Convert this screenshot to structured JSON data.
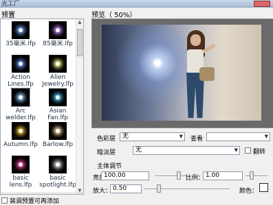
{
  "window": {
    "title": "光工厂"
  },
  "presets": {
    "label": "预置",
    "items": [
      {
        "name": "35毫米.lfp",
        "glow": "#7af"
      },
      {
        "name": "85毫米.lfp",
        "glow": "#c8f"
      },
      {
        "name": "Action Lines.lfp",
        "glow": "#69f"
      },
      {
        "name": "Alien Jewelry.lfp",
        "glow": "#ff8"
      },
      {
        "name": "Arc welder.lfp",
        "glow": "#9cf"
      },
      {
        "name": "Asian Fan.lfp",
        "glow": "#5cf"
      },
      {
        "name": "Autumn.lfp",
        "glow": "#fc3"
      },
      {
        "name": "Barlow.lfp",
        "glow": "#fda"
      },
      {
        "name": "basic lens.lfp",
        "glow": "#f4a"
      },
      {
        "name": "basic spotlight.lfp",
        "glow": "#ddd"
      }
    ],
    "add_checkbox": "装调预置可再添加"
  },
  "preview": {
    "label": "预览（ 50%）"
  },
  "controls": {
    "color_layer_label": "色彩层",
    "color_layer_value": "无",
    "view_label": "查看",
    "view_value": "",
    "fade_layer_label": "暗淡层",
    "fade_layer_value": "无",
    "flip_label": "翻转",
    "group_label": "主体调节",
    "brightness_label": "亮度",
    "brightness_value": "100.00",
    "ratio_label": "比例：",
    "ratio_value": "1.00",
    "zoom_label": "放大：",
    "zoom_value": "0.50",
    "color_label": "颜色：",
    "color_value": "#ffffff"
  }
}
